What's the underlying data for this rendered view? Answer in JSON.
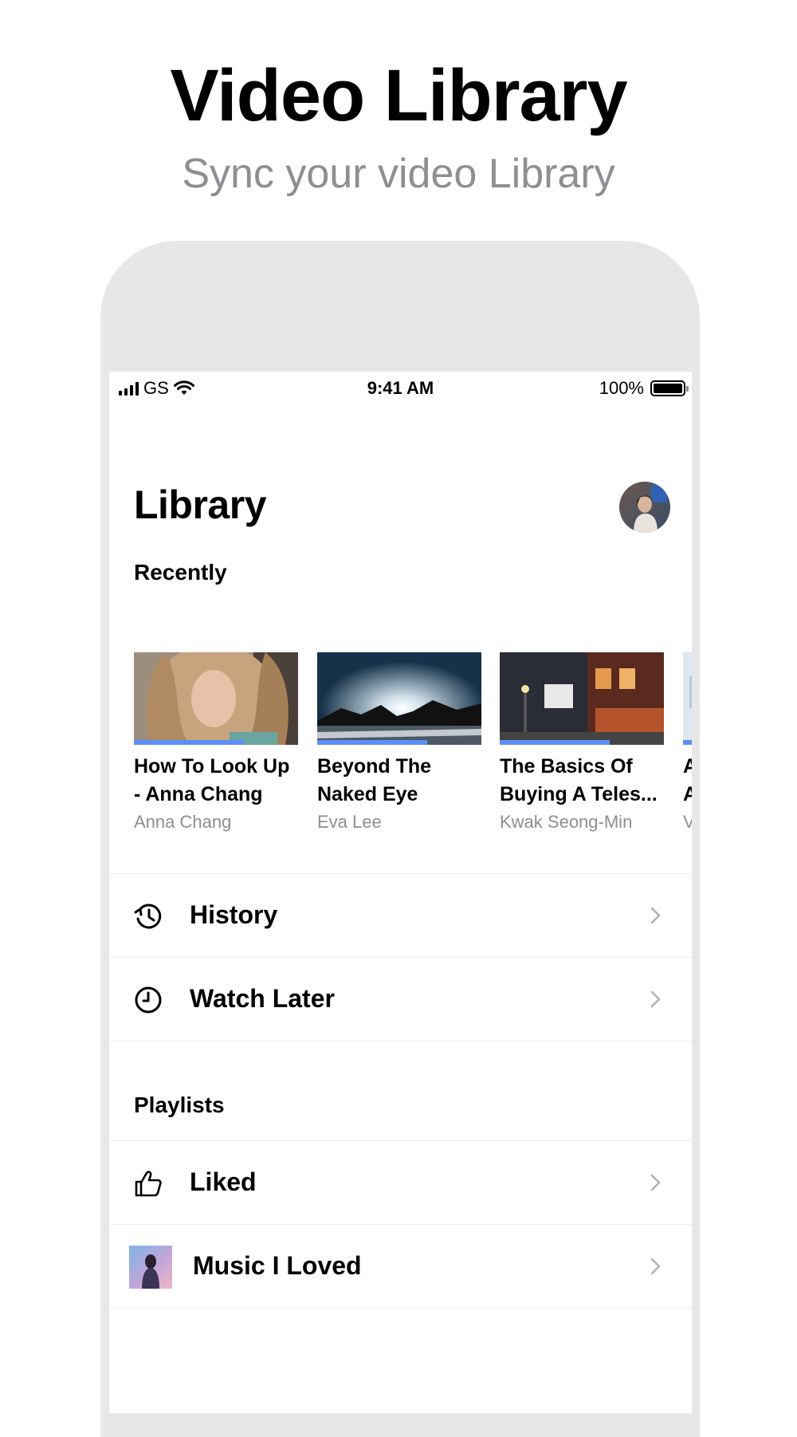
{
  "promo": {
    "title": "Video Library",
    "subtitle": "Sync your video Library"
  },
  "status_bar": {
    "carrier": "GS",
    "time": "9:41 AM",
    "battery": "100%"
  },
  "header": {
    "title": "Library",
    "avatar_icon": "user-avatar"
  },
  "recently": {
    "label": "Recently",
    "videos": [
      {
        "title_line1": "How To Look Up",
        "title_line2": "- Anna Chang",
        "channel": "Anna Chang",
        "progress": 0.67
      },
      {
        "title_line1": "Beyond The",
        "title_line2": "Naked Eye",
        "channel": "Eva Lee",
        "progress": 0.67
      },
      {
        "title_line1": "The Basics Of",
        "title_line2": "Buying A Teles...",
        "channel": "Kwak Seong-Min",
        "progress": 0.67
      },
      {
        "title_line1": "A",
        "title_line2": "A",
        "channel": "V",
        "progress": 0.67
      }
    ]
  },
  "menu": {
    "history": {
      "label": "History",
      "icon": "history-icon"
    },
    "watch_later": {
      "label": "Watch Later",
      "icon": "clock-icon"
    }
  },
  "playlists": {
    "label": "Playlists",
    "items": [
      {
        "label": "Liked",
        "icon": "thumbs-up-icon"
      },
      {
        "label": "Music I Loved",
        "icon": "playlist-thumbnail"
      }
    ]
  },
  "colors": {
    "accent": "#5b8ff9",
    "secondary_text": "#8e8e93",
    "frame": "#e7e7e8"
  }
}
